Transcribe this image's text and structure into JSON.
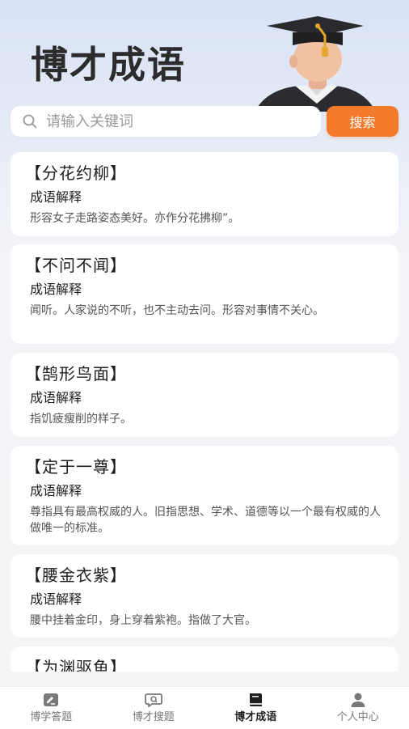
{
  "header": {
    "title": "博才成语"
  },
  "search": {
    "placeholder": "请输入关键词",
    "value": "",
    "button_label": "搜索"
  },
  "idioms": [
    {
      "title": "【分花约柳】",
      "subtitle": "成语解释",
      "desc": "形容女子走路姿态美好。亦作分花拂柳”。"
    },
    {
      "title": "【不问不闻】",
      "subtitle": "成语解释",
      "desc": "闻听。人家说的不听，也不主动去问。形容对事情不关心。"
    },
    {
      "title": "【鹄形鸟面】",
      "subtitle": "成语解释",
      "desc": "指饥疲瘦削的样子。"
    },
    {
      "title": "【定于一尊】",
      "subtitle": "成语解释",
      "desc": "尊指具有最高权威的人。旧指思想、学术、道德等以一个最有权威的人做唯一的标准。"
    },
    {
      "title": "【腰金衣紫】",
      "subtitle": "成语解释",
      "desc": "腰中挂着金印，身上穿着紫袍。指做了大官。"
    },
    {
      "title": "【为渊驱鱼】",
      "subtitle": "",
      "desc": ""
    }
  ],
  "bottom_nav": {
    "items": [
      {
        "label": "博学答题",
        "icon": "quiz-icon",
        "active": false
      },
      {
        "label": "博才搜题",
        "icon": "search-question-icon",
        "active": false
      },
      {
        "label": "博才成语",
        "icon": "book-icon",
        "active": true
      },
      {
        "label": "个人中心",
        "icon": "user-icon",
        "active": false
      }
    ]
  },
  "colors": {
    "accent": "#f47a2c",
    "background_top": "#d8e2f6",
    "card": "#ffffff",
    "nav_active": "#1f1f1f",
    "nav_inactive": "#888888"
  }
}
